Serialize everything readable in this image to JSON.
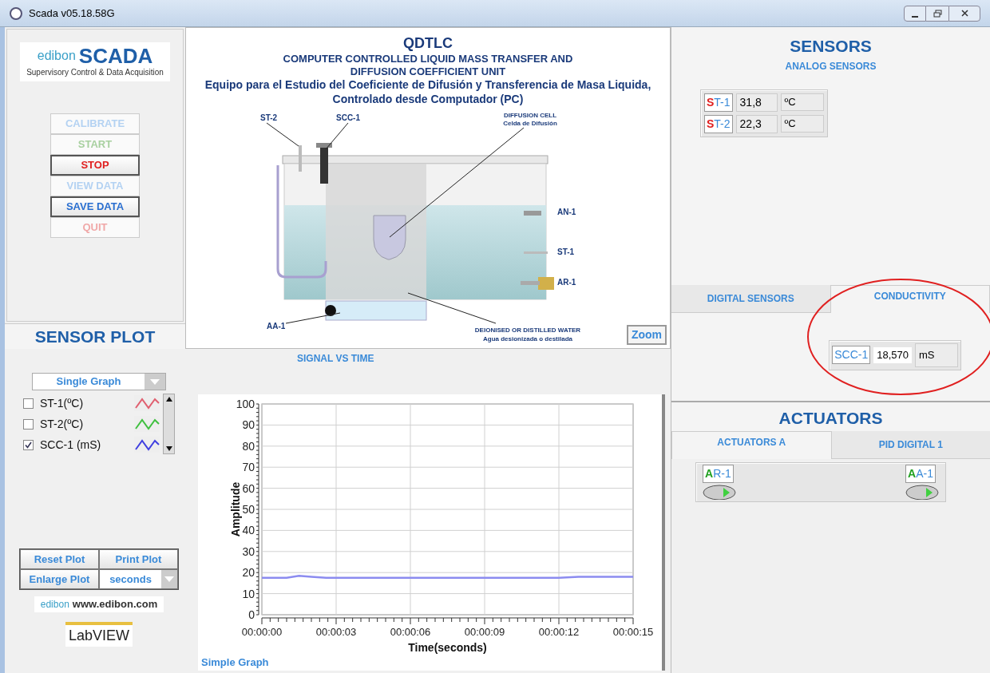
{
  "window": {
    "title": "Scada v05.18.58G"
  },
  "logo": {
    "brand": "edibon",
    "product": "SCADA",
    "tagline": "Supervisory Control & Data Acquisition"
  },
  "controls": [
    {
      "label": "CALIBRATE",
      "color": "#b4d2f2",
      "disabled": true
    },
    {
      "label": "START",
      "color": "#a8d0a0",
      "disabled": true
    },
    {
      "label": "STOP",
      "color": "#e02020",
      "disabled": false
    },
    {
      "label": "VIEW DATA",
      "color": "#b4d2f2",
      "disabled": true
    },
    {
      "label": "SAVE DATA",
      "color": "#2a6fd0",
      "disabled": false
    },
    {
      "label": "QUIT",
      "color": "#f0a8a8",
      "disabled": true
    }
  ],
  "diagram": {
    "code": "QDTLC",
    "title": "COMPUTER CONTROLLED LIQUID MASS TRANSFER AND DIFFUSION COEFFICIENT UNIT",
    "subtitle": "Equipo para el Estudio del Coeficiente de Difusión y Transferencia de Masa Liquida, Controlado desde Computador (PC)",
    "labels": {
      "st2": "ST-2",
      "scc1": "SCC-1",
      "cell": "DIFFUSION CELL",
      "cell_es": "Celda de Difusión",
      "an1": "AN-1",
      "st1": "ST-1",
      "ar1": "AR-1",
      "aa1": "AA-1",
      "water": "DEIONISED OR DISTILLED WATER",
      "water_es": "Agua desionizada o destilada"
    },
    "zoom_button": "Zoom"
  },
  "sensor_plot": {
    "title": "SENSOR PLOT",
    "graph_mode": "Single Graph",
    "channels": [
      {
        "label": "ST-1(ºC)",
        "checked": false,
        "color": "#e06070"
      },
      {
        "label": "ST-2(ºC)",
        "checked": false,
        "color": "#40c040"
      },
      {
        "label": "SCC-1 (mS)",
        "checked": true,
        "color": "#4040e0"
      }
    ],
    "buttons": [
      "Reset Plot",
      "Print Plot",
      "Enlarge Plot"
    ],
    "time_unit": "seconds",
    "website_brand": "edibon",
    "website": "www.edibon.com",
    "labview": "LabVIEW"
  },
  "chart": {
    "title": "SIGNAL VS TIME",
    "footer": "Simple Graph",
    "chart_data": {
      "type": "line",
      "xlabel": "Time(seconds)",
      "ylabel": "Amplitude",
      "x": [
        0,
        1,
        1.5,
        2,
        2.6,
        3,
        4,
        5,
        6,
        7,
        8,
        9,
        10,
        11,
        12,
        12.8,
        13,
        14,
        15
      ],
      "grid": true,
      "series": [
        {
          "color": "#8c8cf0",
          "values": [
            17.5,
            17.5,
            18.5,
            18,
            17.5,
            17.5,
            17.5,
            17.5,
            17.5,
            17.5,
            17.5,
            17.5,
            17.5,
            17.5,
            17.5,
            18,
            18,
            18,
            18
          ]
        }
      ],
      "xlim": [
        0,
        15
      ],
      "ylim": [
        0,
        100
      ],
      "xticks": [
        {
          "value": 0,
          "label": "00:00:00"
        },
        {
          "value": 3,
          "label": "00:00:03"
        },
        {
          "value": 6,
          "label": "00:00:06"
        },
        {
          "value": 9,
          "label": "00:00:09"
        },
        {
          "value": 12,
          "label": "00:00:12"
        },
        {
          "value": 15,
          "label": "00:00:15"
        }
      ],
      "yticks": [
        0,
        10,
        20,
        30,
        40,
        50,
        60,
        70,
        80,
        90,
        100
      ]
    }
  },
  "sensors": {
    "title": "SENSORS",
    "section": "ANALOG SENSORS",
    "analog": [
      {
        "label": "ST-1",
        "value": "31,8",
        "unit": "ºC"
      },
      {
        "label": "ST-2",
        "value": "22,3",
        "unit": "ºC"
      }
    ],
    "tabs": [
      {
        "label": "DIGITAL SENSORS",
        "selected": false
      },
      {
        "label": "CONDUCTIVITY",
        "selected": true
      }
    ],
    "conductivity": {
      "label": "SCC-1",
      "value": "18,570",
      "unit": "mS"
    }
  },
  "actuators": {
    "title": "ACTUATORS",
    "tabs": [
      {
        "label": "ACTUATORS A",
        "selected": true
      },
      {
        "label": "PID DIGITAL 1",
        "selected": false
      }
    ],
    "items": [
      {
        "label": "AR-1"
      },
      {
        "label": "AA-1"
      }
    ]
  }
}
